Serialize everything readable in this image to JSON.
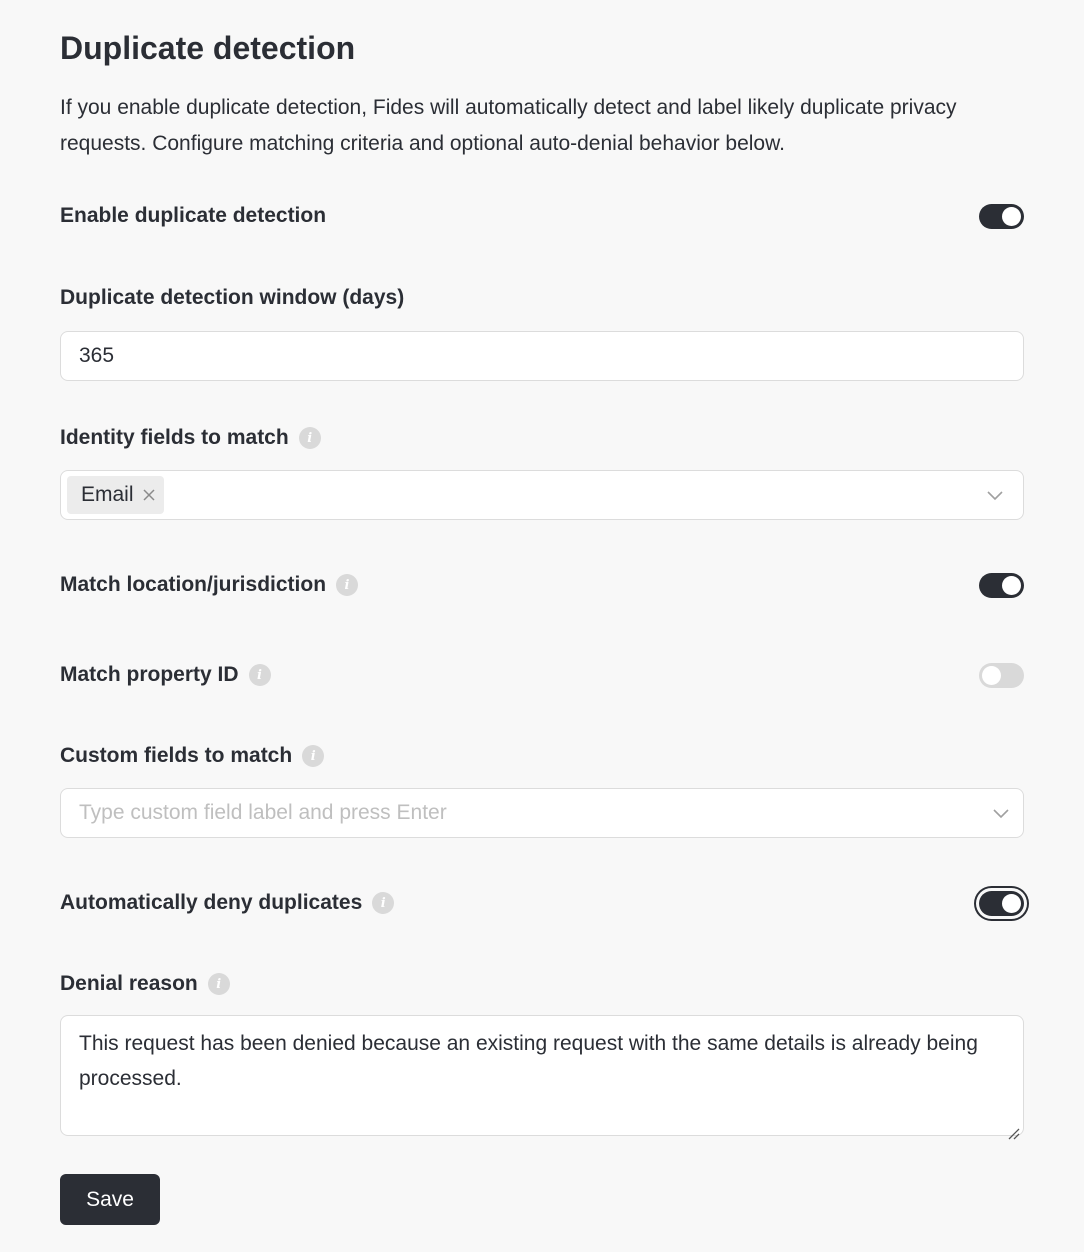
{
  "title": "Duplicate detection",
  "description": "If you enable duplicate detection, Fides will automatically detect and label likely duplicate privacy requests. Configure matching criteria and optional auto-denial behavior below.",
  "enable": {
    "label": "Enable duplicate detection",
    "on": true
  },
  "window": {
    "label": "Duplicate detection window (days)",
    "value": "365"
  },
  "identity": {
    "label": "Identity fields to match",
    "tags": [
      "Email"
    ],
    "info_icon": "info-icon"
  },
  "location": {
    "label": "Match location/jurisdiction",
    "on": true
  },
  "property": {
    "label": "Match property ID",
    "on": false
  },
  "custom": {
    "label": "Custom fields to match",
    "placeholder": "Type custom field label and press Enter"
  },
  "auto_deny": {
    "label": "Automatically deny duplicates",
    "on": true
  },
  "denial": {
    "label": "Denial reason",
    "value": "This request has been denied because an existing request with the same details is already being processed."
  },
  "save_label": "Save",
  "colors": {
    "primary": "#2b2e35",
    "background": "#f8f8f8",
    "border": "#dcdcdc",
    "toggle_off": "#d9d9d9"
  }
}
